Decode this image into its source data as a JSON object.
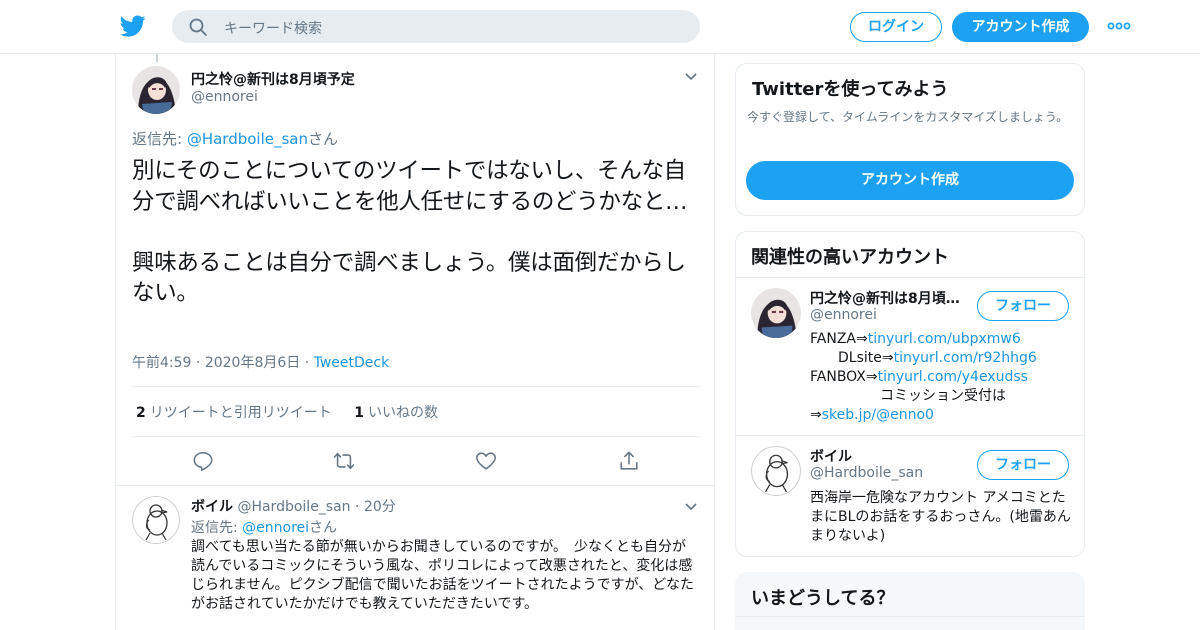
{
  "header": {
    "search_placeholder": "キーワード検索",
    "login_label": "ログイン",
    "signup_label": "アカウント作成"
  },
  "tweet": {
    "author_name": "円之怜@新刊は8月頃予定",
    "author_handle": "@ennorei",
    "reply_prefix": "返信先: ",
    "reply_to": "@Hardboile_san",
    "reply_suffix": "さん",
    "text": "別にそのことについてのツイートではないし、そんな自分で調べればいいことを他人任せにするのどうかなと…\n\n興味あることは自分で調べましょう。僕は面倒だからしない。",
    "time": "午前4:59",
    "date": "2020年8月6日",
    "source": "TweetDeck",
    "retweets_count": "2",
    "retweets_label": "リツイートと引用リツイート",
    "likes_count": "1",
    "likes_label": "いいねの数"
  },
  "reply": {
    "author_name": "ボイル",
    "author_handle": "@Hardboile_san",
    "time_ago": "20分",
    "reply_prefix": "返信先: ",
    "reply_to": "@ennorei",
    "reply_suffix": "さん",
    "text": "調べても思い当たる節が無いからお聞きしているのですが。　少なくとも自分が読んでいるコミックにそういう風な、ポリコレによって改悪されたと、変化は感じられません。ピクシブ配信で聞いたお話をツイートされたようですが、どなたがお話されていたかだけでも教えていただきたいです。"
  },
  "sidebar": {
    "signup_card": {
      "title": "Twitterを使ってみよう",
      "desc": "今すぐ登録して、タイムラインをカスタマイズしましょう。",
      "button": "アカウント作成"
    },
    "related": {
      "title": "関連性の高いアカウント",
      "accounts": [
        {
          "name": "円之怜@新刊は8月頃予定",
          "handle": "@ennorei",
          "follow": "フォロー",
          "bio": {
            "l1_text": "FANZA⇒",
            "l1_link": "tinyurl.com/ubpxmw6",
            "l2_text": "　　DLsite⇒",
            "l2_link": "tinyurl.com/r92hhg6",
            "l3_text": "FANBOX⇒",
            "l3_link": "tinyurl.com/y4exudss",
            "l4_text": "　　　　　コミッション受付は",
            "l5_text": "⇒",
            "l5_link": "skeb.jp/@enno0"
          }
        },
        {
          "name": "ボイル",
          "handle": "@Hardboile_san",
          "follow": "フォロー",
          "bio": "西海岸一危険なアカウント アメコミとたまにBLのお話をするおっさん。(地雷あんまりないよ)"
        }
      ]
    },
    "trends": {
      "title": "いまどうしてる？"
    }
  },
  "colors": {
    "accent": "#1da1f2",
    "link": "#1b95e0",
    "muted": "#657786",
    "border": "#e6ecf0"
  }
}
